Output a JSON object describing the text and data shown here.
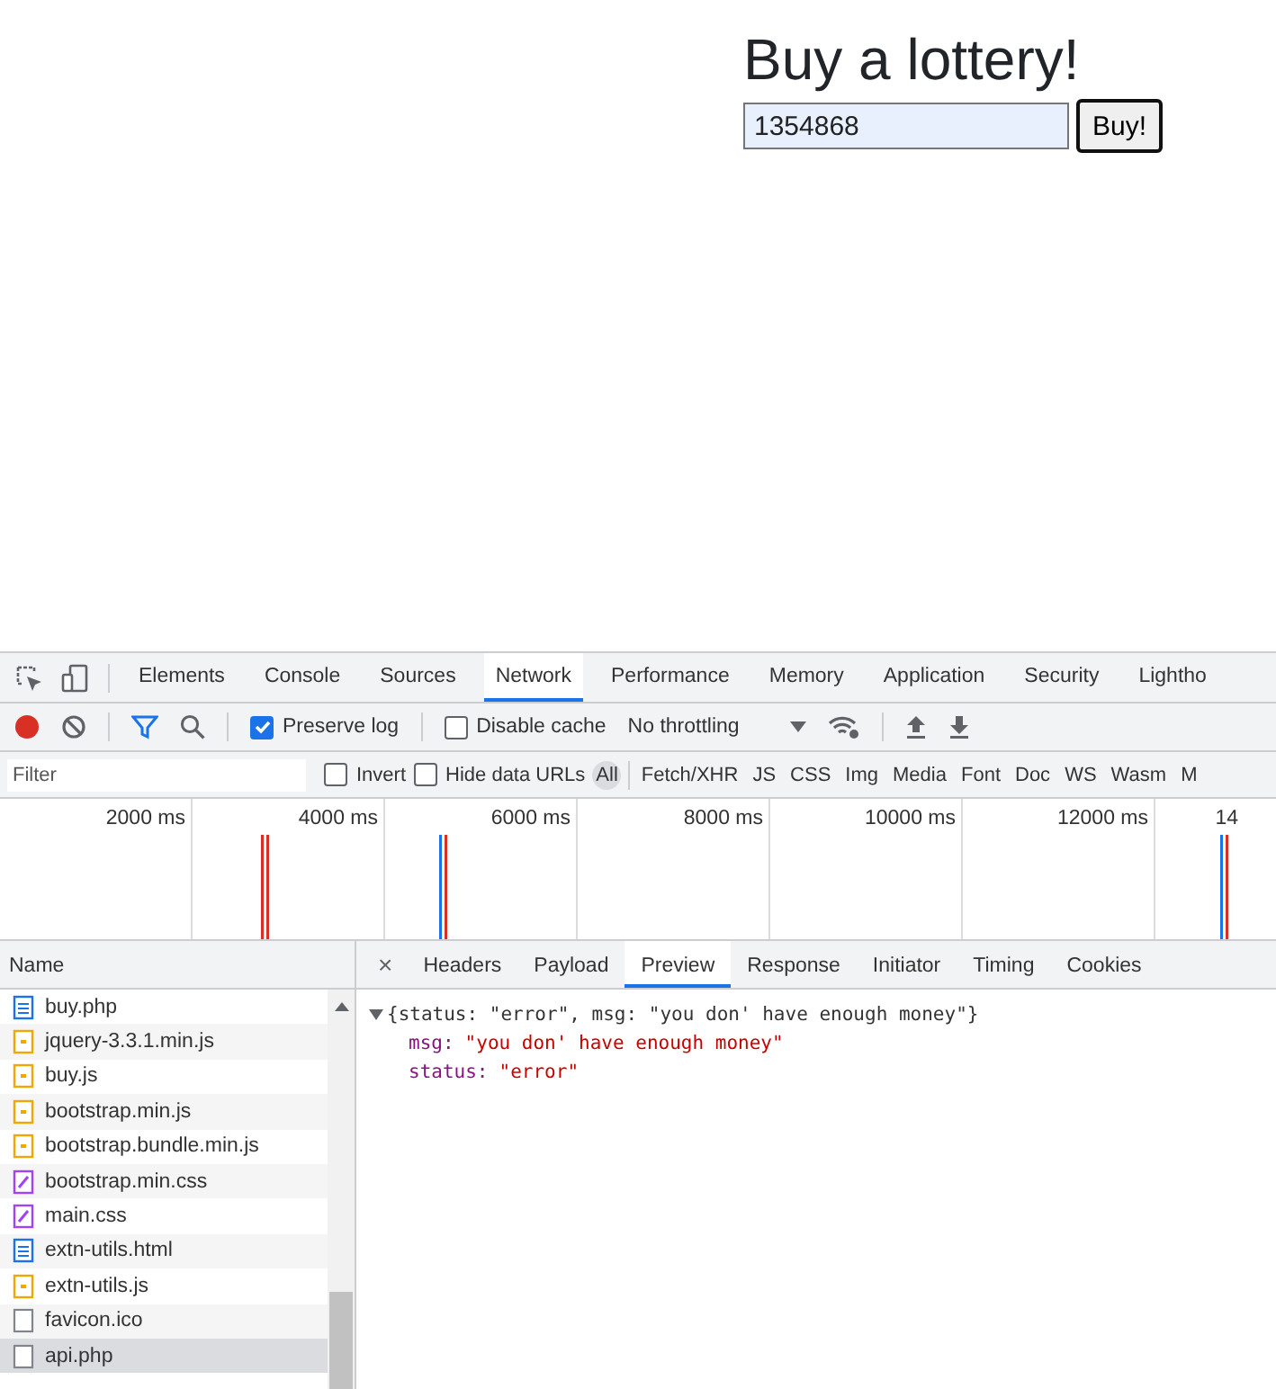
{
  "page": {
    "heading": "Buy a lottery!",
    "input": {
      "value": "1354868"
    },
    "button": "Buy!"
  },
  "devtools": {
    "tabs": [
      {
        "label": "Elements",
        "selected": false
      },
      {
        "label": "Console",
        "selected": false
      },
      {
        "label": "Sources",
        "selected": false
      },
      {
        "label": "Network",
        "selected": true
      },
      {
        "label": "Performance",
        "selected": false
      },
      {
        "label": "Memory",
        "selected": false
      },
      {
        "label": "Application",
        "selected": false
      },
      {
        "label": "Security",
        "selected": false
      },
      {
        "label": "Lightho",
        "selected": false
      }
    ],
    "toolbar": {
      "recording": true,
      "preserve_log": {
        "label": "Preserve log",
        "checked": true
      },
      "disable_cache": {
        "label": "Disable cache",
        "checked": false
      },
      "throttling": "No throttling"
    },
    "filter": {
      "placeholder": "Filter",
      "invert": {
        "label": "Invert",
        "checked": false
      },
      "hide_data_urls": {
        "label": "Hide data URLs",
        "checked": false
      },
      "types": [
        {
          "label": "All",
          "selected": true
        },
        {
          "label": "Fetch/XHR",
          "selected": false
        },
        {
          "label": "JS",
          "selected": false
        },
        {
          "label": "CSS",
          "selected": false
        },
        {
          "label": "Img",
          "selected": false
        },
        {
          "label": "Media",
          "selected": false
        },
        {
          "label": "Font",
          "selected": false
        },
        {
          "label": "Doc",
          "selected": false
        },
        {
          "label": "WS",
          "selected": false
        },
        {
          "label": "Wasm",
          "selected": false
        },
        {
          "label": "M",
          "selected": false
        }
      ]
    },
    "timeline": {
      "ticks": [
        "2000 ms",
        "4000 ms",
        "6000 ms",
        "8000 ms",
        "10000 ms",
        "12000 ms",
        "14"
      ]
    },
    "requests": {
      "column": "Name",
      "rows": [
        {
          "name": "buy.php",
          "kind": "doc",
          "selected": false
        },
        {
          "name": "jquery-3.3.1.min.js",
          "kind": "script",
          "selected": false
        },
        {
          "name": "buy.js",
          "kind": "script",
          "selected": false
        },
        {
          "name": "bootstrap.min.js",
          "kind": "script",
          "selected": false
        },
        {
          "name": "bootstrap.bundle.min.js",
          "kind": "script",
          "selected": false
        },
        {
          "name": "bootstrap.min.css",
          "kind": "style",
          "selected": false
        },
        {
          "name": "main.css",
          "kind": "style",
          "selected": false
        },
        {
          "name": "extn-utils.html",
          "kind": "doc",
          "selected": false
        },
        {
          "name": "extn-utils.js",
          "kind": "script",
          "selected": false
        },
        {
          "name": "favicon.ico",
          "kind": "other",
          "selected": false
        },
        {
          "name": "api.php",
          "kind": "other",
          "selected": true
        }
      ]
    },
    "detail": {
      "close": "×",
      "tabs": [
        {
          "label": "Headers",
          "selected": false
        },
        {
          "label": "Payload",
          "selected": false
        },
        {
          "label": "Preview",
          "selected": true
        },
        {
          "label": "Response",
          "selected": false
        },
        {
          "label": "Initiator",
          "selected": false
        },
        {
          "label": "Timing",
          "selected": false
        },
        {
          "label": "Cookies",
          "selected": false
        }
      ],
      "preview": {
        "summary": "{status: \"error\", msg: \"you don' have enough money\"}",
        "expanded": true,
        "properties": [
          {
            "key": "msg:",
            "value": "\"you don' have enough money\""
          },
          {
            "key": "status:",
            "value": "\"error\""
          }
        ]
      }
    }
  }
}
